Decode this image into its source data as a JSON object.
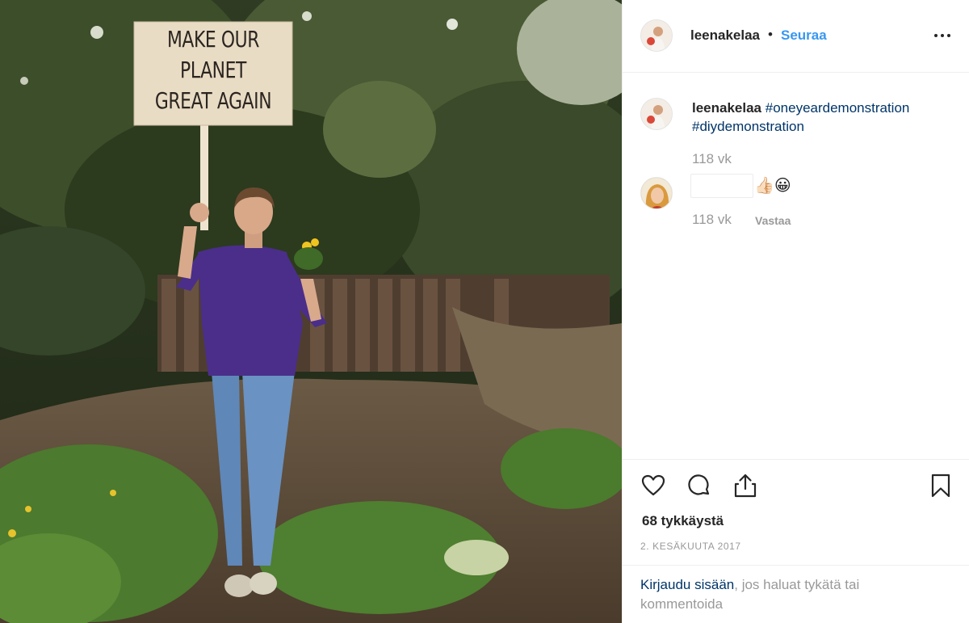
{
  "photo": {
    "sign_lines": [
      "MAKE OUR",
      "PLANET",
      "GREAT AGAIN"
    ]
  },
  "header": {
    "username": "leenakelaa",
    "separator": "•",
    "follow_label": "Seuraa",
    "more_icon": "more-horizontal-icon"
  },
  "caption": {
    "username": "leenakelaa",
    "hashtags": [
      "#oneyeardemonstration",
      "#diydemonstration"
    ],
    "time": "118 vk"
  },
  "comment": {
    "emoji": "👍🏻😀",
    "time": "118 vk",
    "reply_label": "Vastaa"
  },
  "actions": {
    "icons": [
      "heart-icon",
      "comment-icon",
      "share-icon",
      "bookmark-icon"
    ],
    "likes": "68 tykkäystä",
    "date": "2. KESÄKUUTA 2017"
  },
  "login": {
    "link": "Kirjaudu sisään",
    "text": ", jos haluat tykätä tai kommentoida"
  },
  "colors": {
    "accent_blue": "#3897f0",
    "link_dark": "#003569",
    "muted": "#999999",
    "text": "#262626"
  }
}
